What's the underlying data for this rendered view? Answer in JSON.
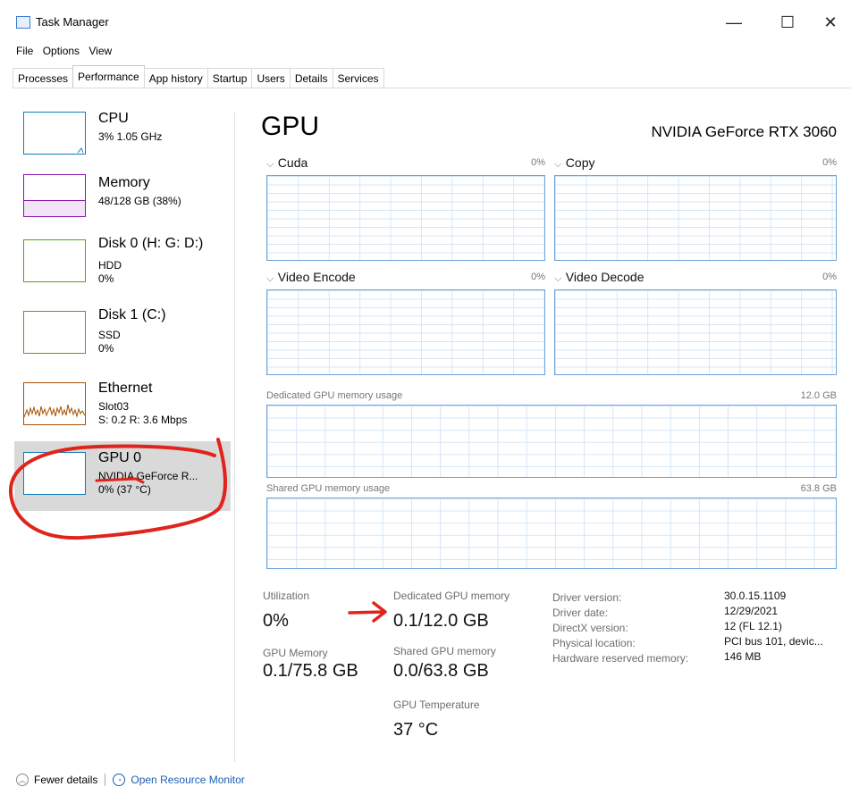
{
  "window": {
    "title": "Task Manager",
    "minimize": "—",
    "maximize": "☐",
    "close": "✕"
  },
  "menu": [
    "File",
    "Options",
    "View"
  ],
  "tabs": [
    "Processes",
    "Performance",
    "App history",
    "Startup",
    "Users",
    "Details",
    "Services"
  ],
  "sidebar": [
    {
      "name": "CPU",
      "line1": "3% 1.05 GHz",
      "line2": "",
      "color": "#117dbb"
    },
    {
      "name": "Memory",
      "line1": "48/128 GB (38%)",
      "line2": "",
      "color": "#8b12ae",
      "fill_fraction": 0.38
    },
    {
      "name": "Disk 0 (H: G: D:)",
      "line1": "HDD",
      "line2": "0%",
      "color": "#4da60c"
    },
    {
      "name": "Disk 1 (C:)",
      "line1": "SSD",
      "line2": "0%",
      "color": "#4da60c"
    },
    {
      "name": "Ethernet",
      "line1": "Slot03",
      "line2": "S: 0.2 R: 3.6 Mbps",
      "color": "#a74f01"
    },
    {
      "name": "GPU 0",
      "line1": "NVIDIA GeForce R...",
      "line2": "0% (37 °C)",
      "color": "#117dbb"
    }
  ],
  "gpu": {
    "title": "GPU",
    "model": "NVIDIA GeForce RTX 3060",
    "engines": [
      {
        "name": "Cuda",
        "pct": "0%"
      },
      {
        "name": "Copy",
        "pct": "0%"
      },
      {
        "name": "Video Encode",
        "pct": "0%"
      },
      {
        "name": "Video Decode",
        "pct": "0%"
      }
    ],
    "dedicated_label": "Dedicated GPU memory usage",
    "dedicated_max": "12.0 GB",
    "shared_label": "Shared GPU memory usage",
    "shared_max": "63.8 GB"
  },
  "stats": {
    "utilization_label": "Utilization",
    "utilization": "0%",
    "dedicated_label": "Dedicated GPU memory",
    "dedicated": "0.1/12.0 GB",
    "gpu_memory_label": "GPU Memory",
    "gpu_memory": "0.1/75.8 GB",
    "shared_label": "Shared GPU memory",
    "shared": "0.0/63.8 GB",
    "temp_label": "GPU Temperature",
    "temp": "37 °C"
  },
  "info": [
    {
      "label": "Driver version:",
      "value": "30.0.15.1109"
    },
    {
      "label": "Driver date:",
      "value": "12/29/2021"
    },
    {
      "label": "DirectX version:",
      "value": "12 (FL 12.1)"
    },
    {
      "label": "Physical location:",
      "value": "PCI bus 101, devic..."
    },
    {
      "label": "Hardware reserved memory:",
      "value": "146 MB"
    }
  ],
  "footer": {
    "fewer": "Fewer details",
    "monitor": "Open Resource Monitor"
  },
  "annotation_color": "#e0241b"
}
